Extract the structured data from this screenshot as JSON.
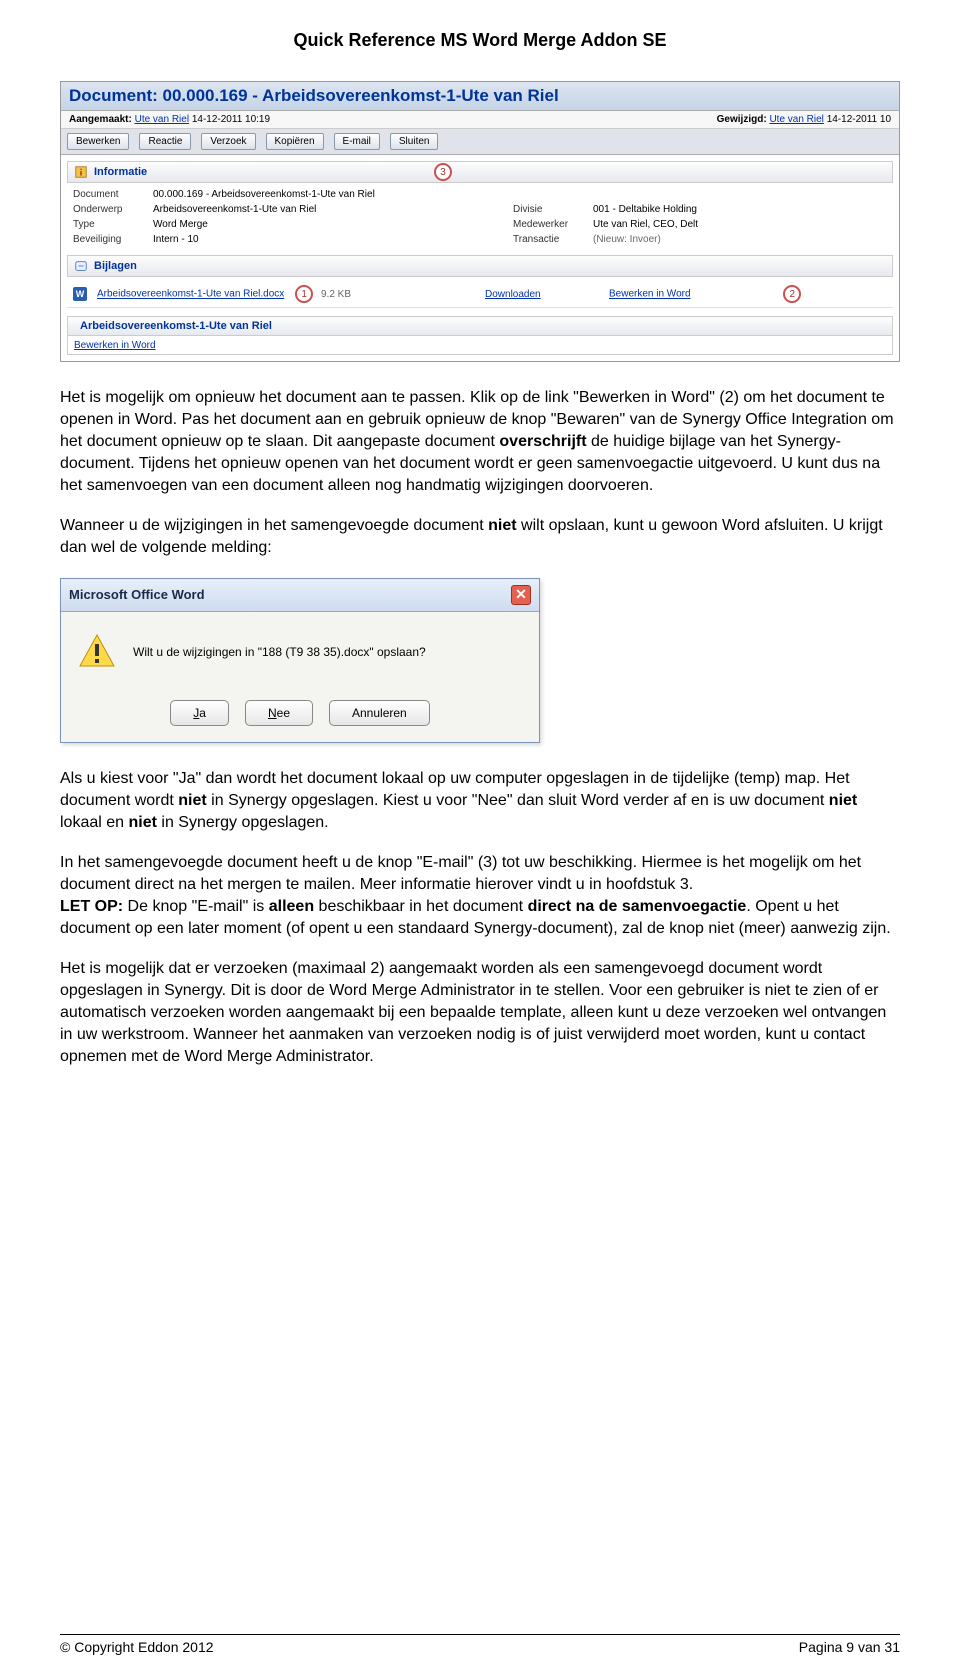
{
  "doc_title": "Quick Reference MS Word Merge Addon SE",
  "app": {
    "title": "Document: 00.000.169 - Arbeidsovereenkomst-1-Ute van Riel",
    "meta": {
      "created_label": "Aangemaakt:",
      "created_user": "Ute van Riel",
      "created_date": "14-12-2011 10:19",
      "modified_label": "Gewijzigd:",
      "modified_user": "Ute van Riel",
      "modified_date": "14-12-2011 10"
    },
    "toolbar": {
      "bewerken": "Bewerken",
      "reactie": "Reactie",
      "verzoek": "Verzoek",
      "kopieren": "Kopiëren",
      "email": "E-mail",
      "sluiten": "Sluiten"
    },
    "info_section": {
      "label": "Informatie",
      "badge": "3",
      "rows": {
        "document_lbl": "Document",
        "document_val": "00.000.169 - Arbeidsovereenkomst-1-Ute van Riel",
        "onderwerp_lbl": "Onderwerp",
        "onderwerp_val": "Arbeidsovereenkomst-1-Ute van Riel",
        "divisie_lbl": "Divisie",
        "divisie_val": "001 - Deltabike Holding",
        "type_lbl": "Type",
        "type_val": "Word Merge",
        "medewerker_lbl": "Medewerker",
        "medewerker_val": "Ute van Riel, CEO, Delt",
        "beveiliging_lbl": "Beveiliging",
        "beveiliging_val": "Intern - 10",
        "transactie_lbl": "Transactie",
        "transactie_val": "(Nieuw: Invoer)"
      }
    },
    "bijlagen_section": {
      "label": "Bijlagen",
      "filename": "Arbeidsovereenkomst-1-Ute van Riel.docx",
      "size": "9.2 KB",
      "download": "Downloaden",
      "edit": "Bewerken in Word",
      "badge1": "1",
      "badge2": "2"
    },
    "sub_section": {
      "label": "Arbeidsovereenkomst-1-Ute van Riel",
      "link": "Bewerken in Word"
    }
  },
  "dialog": {
    "title": "Microsoft Office Word",
    "message": "Wilt u de wijzigingen in \"188 (T9 38 35).docx\" opslaan?",
    "ja": "Ja",
    "nee": "Nee",
    "annuleren": "Annuleren"
  },
  "para1": "Het is mogelijk om opnieuw het document aan te passen. Klik op de link \"Bewerken in Word\" (2) om het document te openen in Word. Pas het document aan en gebruik opnieuw de knop \"Bewaren\" van de Synergy Office Integration om het document opnieuw op te slaan. Dit aangepaste document ",
  "para1b_bold": "overschrijft",
  "para1c": " de huidige bijlage van het Synergy-document. Tijdens het opnieuw openen van het document wordt er geen samenvoegactie uitgevoerd. U kunt dus na het samenvoegen van een document alleen nog handmatig wijzigingen doorvoeren.",
  "para2": "Wanneer u de wijzigingen in het samengevoegde document ",
  "para2b_bold": "niet",
  "para2c": " wilt opslaan, kunt u gewoon Word afsluiten. U krijgt dan wel de volgende melding:",
  "para3a": "Als u kiest voor \"Ja\" dan wordt het document lokaal op uw computer opgeslagen in de tijdelijke (temp) map. Het document wordt ",
  "para3b_bold": "niet",
  "para3c": " in Synergy opgeslagen. Kiest u voor \"Nee\" dan sluit Word verder af en is uw document ",
  "para3d_bold": "niet",
  "para3e": " lokaal en ",
  "para3f_bold": "niet",
  "para3g": " in Synergy opgeslagen.",
  "para4": "In het samengevoegde document heeft u de knop \"E-mail\" (3) tot uw beschikking. Hiermee is het mogelijk om het document direct na het mergen te mailen. Meer informatie hierover vindt u in hoofdstuk 3.",
  "para5a_bold": "LET OP:",
  "para5b": " De knop \"E-mail\" is ",
  "para5c_bold": "alleen",
  "para5d": " beschikbaar in het document ",
  "para5e_bold": "direct na de samenvoegactie",
  "para5f": ". Opent u het document op een later moment (of opent u een standaard Synergy-document), zal de knop niet (meer) aanwezig zijn.",
  "para6": "Het is mogelijk dat er verzoeken (maximaal 2) aangemaakt worden als een samengevoegd document wordt opgeslagen in Synergy. Dit is door de Word Merge Administrator in te stellen. Voor een gebruiker is niet te zien of er automatisch verzoeken worden aangemaakt bij een bepaalde template, alleen kunt u deze verzoeken wel ontvangen in uw werkstroom. Wanneer het aanmaken van verzoeken nodig is of juist verwijderd moet worden, kunt u contact opnemen met de Word Merge Administrator.",
  "footer": {
    "left": "© Copyright Eddon 2012",
    "right": "Pagina 9 van 31"
  }
}
